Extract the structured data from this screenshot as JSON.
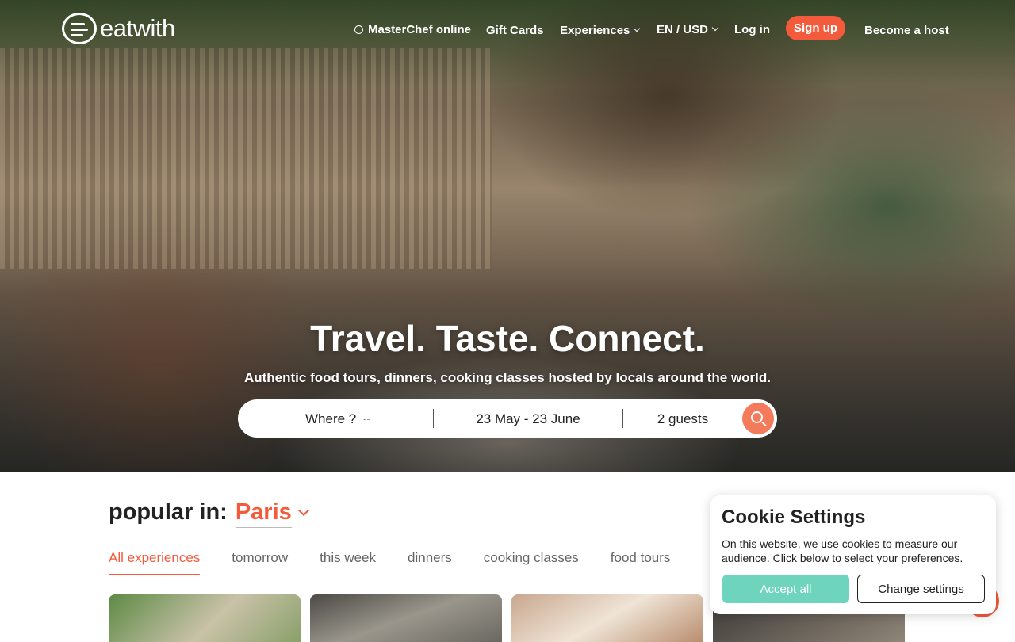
{
  "brand": {
    "name": "eatwith"
  },
  "nav": {
    "masterchef": "MasterChef online",
    "gift_cards": "Gift Cards",
    "experiences": "Experiences",
    "locale": "EN / USD",
    "login": "Log in",
    "signup": "Sign up",
    "become_host": "Become a host"
  },
  "hero": {
    "headline": "Travel. Taste. Connect.",
    "subline": "Authentic food tours, dinners, cooking classes hosted by locals around the world."
  },
  "search": {
    "where_label": "Where ?",
    "where_value": "--",
    "dates": "23 May - 23 June",
    "guests": "2 guests"
  },
  "popular": {
    "prefix": "popular in:",
    "city": "Paris",
    "tabs": [
      "All experiences",
      "tomorrow",
      "this week",
      "dinners",
      "cooking classes",
      "food tours"
    ],
    "active_tab": "All experiences"
  },
  "cookie": {
    "title": "Cookie Settings",
    "text": "On this website, we use cookies to measure our audience. Click below to select your preferences.",
    "accept": "Accept all",
    "change": "Change settings"
  },
  "colors": {
    "accent": "#f45a3c",
    "accept_green": "#6fd4be"
  }
}
